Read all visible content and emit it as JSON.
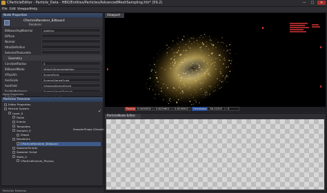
{
  "window": {
    "title": "CParticleEditor - Particle_Data - HBO/Entities/Particles/AdvancedMeshSampling.hfx* (59.2)",
    "min_label": "—",
    "max_label": "□",
    "close_label": "✕"
  },
  "menu": {
    "file": "File",
    "edit": "Edit",
    "viewport": "Viewport",
    "help": "Help"
  },
  "node_properties": {
    "title": "Node Properties",
    "object_name": "CParticleRenderer_Billboard",
    "object_type": "Renderer",
    "rows": [
      {
        "key": "BillboardingMaterial",
        "value": "Additive"
      },
      {
        "key": "Diffuse",
        "value": ""
      },
      {
        "key": "Normal",
        "value": ""
      },
      {
        "key": "AtlasDefinition",
        "value": ""
      },
      {
        "key": "SelectedTextureIds",
        "value": ""
      }
    ],
    "group_label": "Geometry",
    "geo_rows": [
      {
        "key": "ConstantRadius",
        "value": "0"
      },
      {
        "key": "BillboardMode",
        "value": "VelocitySpheroidalAlign"
      },
      {
        "key": "VFlipUVs",
        "value": "ScreenPoint"
      },
      {
        "key": "AxisScale",
        "value": "ScreenAlignedQuad"
      },
      {
        "key": "AxisField",
        "value": "ViewposAlignedQuad"
      },
      {
        "key": "EnablePostersor",
        "value": "ScreenAlignedTriangle"
      },
      {
        "key": "Rotation",
        "value": "VelocityAxisAligned"
      },
      {
        "key": "Size",
        "value": "VelocityCapsuleAlign"
      },
      {
        "key": "TextureIDField",
        "value": "VelocitySpheroidalAlign"
      }
    ],
    "dropdown_options": [
      "PlanarAlignedQuad"
    ],
    "node_properties_label": "Node Properties"
  },
  "particle_treeview": {
    "title": "Particles Treeview",
    "items": [
      {
        "label": "Editor Properties",
        "depth": 0
      },
      {
        "label": "Particle System",
        "depth": 0
      },
      {
        "label": "Layer_0",
        "depth": 1
      },
      {
        "label": "Fields",
        "depth": 2
      },
      {
        "label": "Events",
        "depth": 2
      },
      {
        "label": "Templates",
        "depth": 2
      },
      {
        "label": "Sampler_0",
        "depth": 2
      },
      {
        "label": "Shape",
        "depth": 3
      },
      {
        "label": "Renderers",
        "depth": 2
      },
      {
        "label": "CParticleRenderer_Billboard",
        "depth": 3
      },
      {
        "label": "SpawnerScripts",
        "depth": 2
      },
      {
        "label": "Spawner Script",
        "depth": 2
      },
      {
        "label": "State_0",
        "depth": 2
      },
      {
        "label": "CParticleEvolver_Physics",
        "depth": 3
      }
    ],
    "inline_label": "SamplerShape (Simple)",
    "footer": "Particles Treeview"
  },
  "viewport": {
    "title": "Viewport",
    "stats": [
      "Position",
      "0.0000000",
      "0.8229602",
      "0.8236902",
      "Orientation",
      "-56.12203",
      "0"
    ]
  },
  "particle_node_editor": {
    "title": "ParticleNode Editor"
  }
}
